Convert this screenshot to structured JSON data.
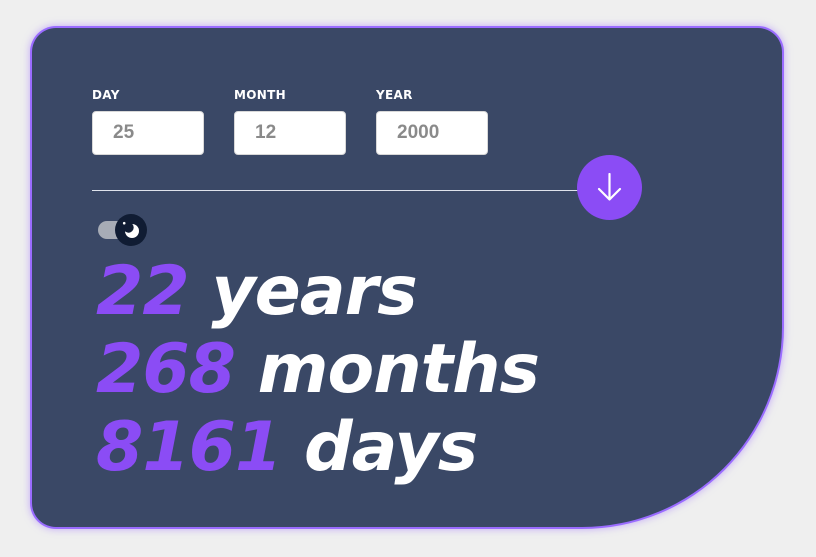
{
  "form": {
    "day": {
      "label": "DAY",
      "value": "25"
    },
    "month": {
      "label": "MONTH",
      "value": "12"
    },
    "year": {
      "label": "YEAR",
      "value": "2000"
    }
  },
  "submit_icon": "arrow-down-icon",
  "theme_toggle": {
    "icon": "moon-icon",
    "state": "dark"
  },
  "results": [
    {
      "number": "22",
      "unit": "years"
    },
    {
      "number": "268",
      "unit": "months"
    },
    {
      "number": "8161",
      "unit": "days"
    }
  ],
  "colors": {
    "page_background": "#efefef",
    "card_background": "#3a4866",
    "accent": "#8b4cf5",
    "text_light": "#ffffff"
  }
}
